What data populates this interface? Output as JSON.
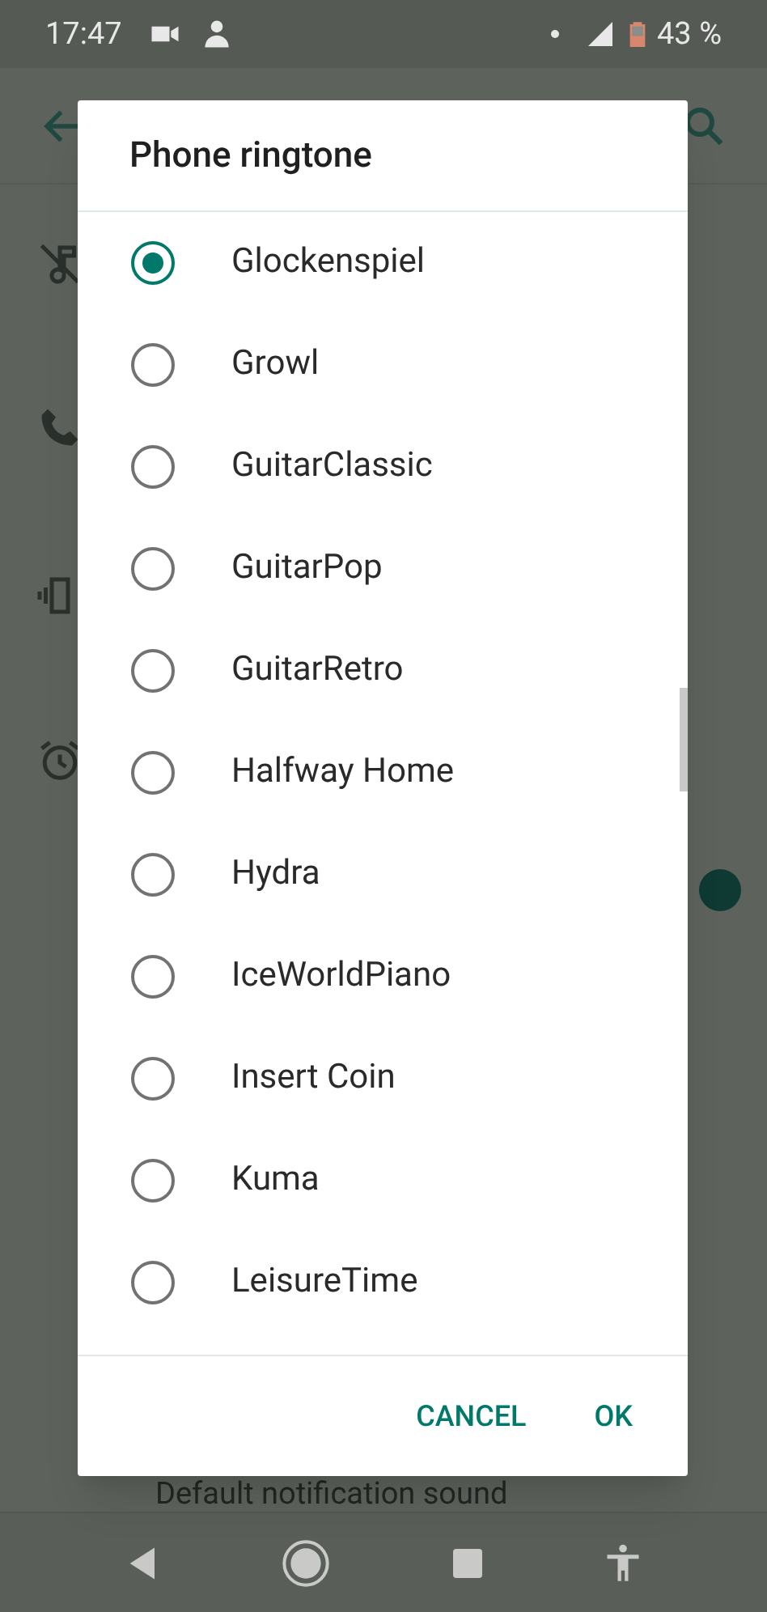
{
  "status_bar": {
    "time": "17:47",
    "battery": "43 %"
  },
  "background": {
    "toggle": {
      "on": true
    },
    "partial_text": "Default notification sound"
  },
  "dialog": {
    "title": "Phone ringtone",
    "options": [
      {
        "label": "Glockenspiel",
        "selected": true
      },
      {
        "label": "Growl",
        "selected": false
      },
      {
        "label": "GuitarClassic",
        "selected": false
      },
      {
        "label": "GuitarPop",
        "selected": false
      },
      {
        "label": "GuitarRetro",
        "selected": false
      },
      {
        "label": "Halfway Home",
        "selected": false
      },
      {
        "label": "Hydra",
        "selected": false
      },
      {
        "label": "IceWorldPiano",
        "selected": false
      },
      {
        "label": "Insert Coin",
        "selected": false
      },
      {
        "label": "Kuma",
        "selected": false
      },
      {
        "label": "LeisureTime",
        "selected": false
      }
    ],
    "buttons": [
      "CANCEL",
      "OK"
    ]
  }
}
